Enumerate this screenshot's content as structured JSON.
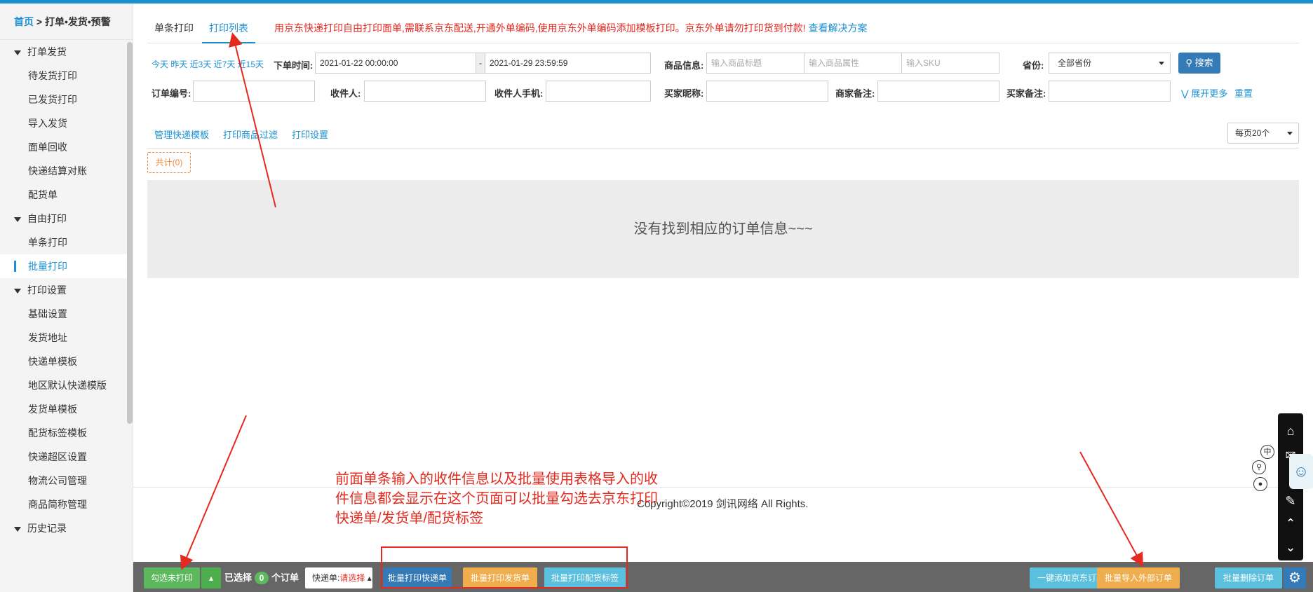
{
  "breadcrumb": {
    "home": "首页",
    "sep": ">",
    "current": "打单•发货•预警"
  },
  "sidebar": {
    "groups": [
      {
        "label": "打单发货",
        "items": [
          "待发货打印",
          "已发货打印",
          "导入发货",
          "面单回收",
          "快递结算对账",
          "配货单"
        ]
      },
      {
        "label": "自由打印",
        "items": [
          "单条打印",
          "批量打印"
        ]
      },
      {
        "label": "打印设置",
        "items": [
          "基础设置",
          "发货地址",
          "快递单模板",
          "地区默认快递模版",
          "发货单模板",
          "配货标签模板",
          "快递超区设置",
          "物流公司管理",
          "商品简称管理"
        ]
      },
      {
        "label": "历史记录",
        "items": []
      }
    ],
    "active_item": "批量打印"
  },
  "tabs": [
    {
      "label": "单条打印"
    },
    {
      "label": "打印列表"
    }
  ],
  "notice": {
    "text": "用京东快递打印自由打印面单,需联系京东配送,开通外单编码,使用京东外单编码添加模板打印。京东外单请勿打印货到付款!",
    "link": "查看解决方案"
  },
  "filters": {
    "quick_dates": "今天 昨天 近3天 近7天 近15天",
    "order_time_label": "下单时间:",
    "date_from": "2021-01-22 00:00:00",
    "date_sep": "-",
    "date_to": "2021-01-29 23:59:59",
    "goods_label": "商品信息:",
    "goods_title_ph": "输入商品标题",
    "goods_attr_ph": "输入商品属性",
    "sku_ph": "输入SKU",
    "province_label": "省份:",
    "province_value": "全部省份",
    "search_button": "搜索",
    "order_no_label": "订单编号:",
    "receiver_label": "收件人:",
    "receiver_phone_label": "收件人手机:",
    "buyer_nick_label": "买家昵称:",
    "merchant_note_label": "商家备注:",
    "buyer_note_label": "买家备注:",
    "expand_more": "展开更多",
    "reset": "重置"
  },
  "toolbar": {
    "manage_templates": "管理快递模板",
    "print_filter": "打印商品过滤",
    "print_settings": "打印设置",
    "page_size": "每页20个"
  },
  "total_label": "共计(0)",
  "empty_message": "没有找到相应的订单信息~~~",
  "annotation": "前面单条输入的收件信息以及批量使用表格导入的收件信息都会显示在这个页面可以批量勾选去京东打印快递单/发货单/配货标签",
  "copyright": "Copyright©2019 剑讯网络 All Rights.",
  "bottom_bar": {
    "select_unprinted": "勾选未打印",
    "selected_prefix": "已选择",
    "selected_count": "0",
    "selected_suffix": "个订单",
    "express_label": "快递单:",
    "express_value": "请选择",
    "batch_print_express": "批量打印快递单",
    "batch_print_invoice": "批量打印发货单",
    "batch_print_label": "批量打印配货标签",
    "add_jd_order": "一键添加京东订单",
    "import_external": "批量导入外部订单",
    "batch_delete": "批量删除订单"
  },
  "right_tools": {
    "lang": "中"
  },
  "colors": {
    "accent": "#1a90d2",
    "red": "#e4291f",
    "orange": "#f0ad4e",
    "green": "#5cb85c"
  }
}
